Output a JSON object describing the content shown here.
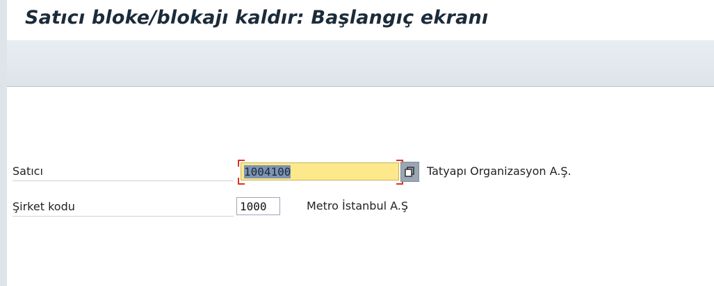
{
  "window": {
    "title": "Satıcı bloke/blokajı kaldır: Başlangıç ekranı"
  },
  "form": {
    "vendor": {
      "label": "Satıcı",
      "value": "1004100",
      "description": "Tatyapı Organizasyon A.Ş."
    },
    "company_code": {
      "label": "Şirket kodu",
      "value": "1000",
      "description": "Metro İstanbul A.Ş"
    }
  },
  "colors": {
    "required_field_bg": "#fde98c",
    "selection_bg": "#7d94b2",
    "focus_bracket": "#e03020"
  },
  "icons": {
    "value_help": "value-help-icon"
  }
}
